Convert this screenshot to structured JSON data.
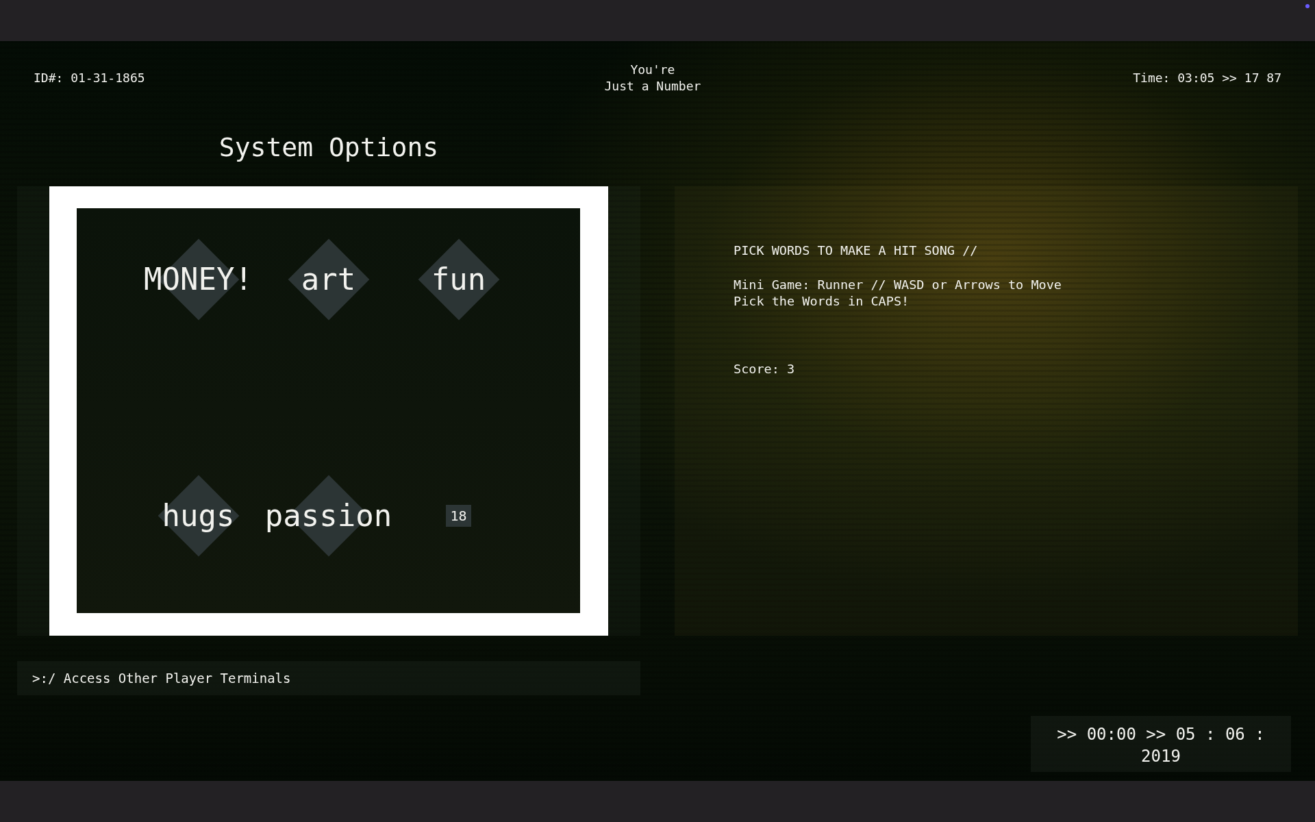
{
  "header": {
    "id": "ID#: 01-31-1865",
    "title_lines": [
      "You're",
      "Just a Number"
    ],
    "time": "Time: 03:05 >> 17 87"
  },
  "panel_title": "System Options",
  "game": {
    "items": [
      {
        "kind": "word",
        "label": "MONEY!"
      },
      {
        "kind": "word",
        "label": "art"
      },
      {
        "kind": "word",
        "label": "fun"
      },
      {
        "kind": "word",
        "label": "hugs"
      },
      {
        "kind": "word",
        "label": "passion"
      },
      {
        "kind": "counter",
        "label": "18"
      }
    ]
  },
  "info": {
    "heading": "PICK WORDS TO MAKE A HIT SONG //",
    "instructions": [
      "Mini Game: Runner // WASD or Arrows to Move",
      "Pick the Words in CAPS!"
    ],
    "score": "Score: 3"
  },
  "terminal_link": ">:/ Access Other Player Terminals",
  "clock": ">> 00:00 >> 05 : 06 : 2019"
}
